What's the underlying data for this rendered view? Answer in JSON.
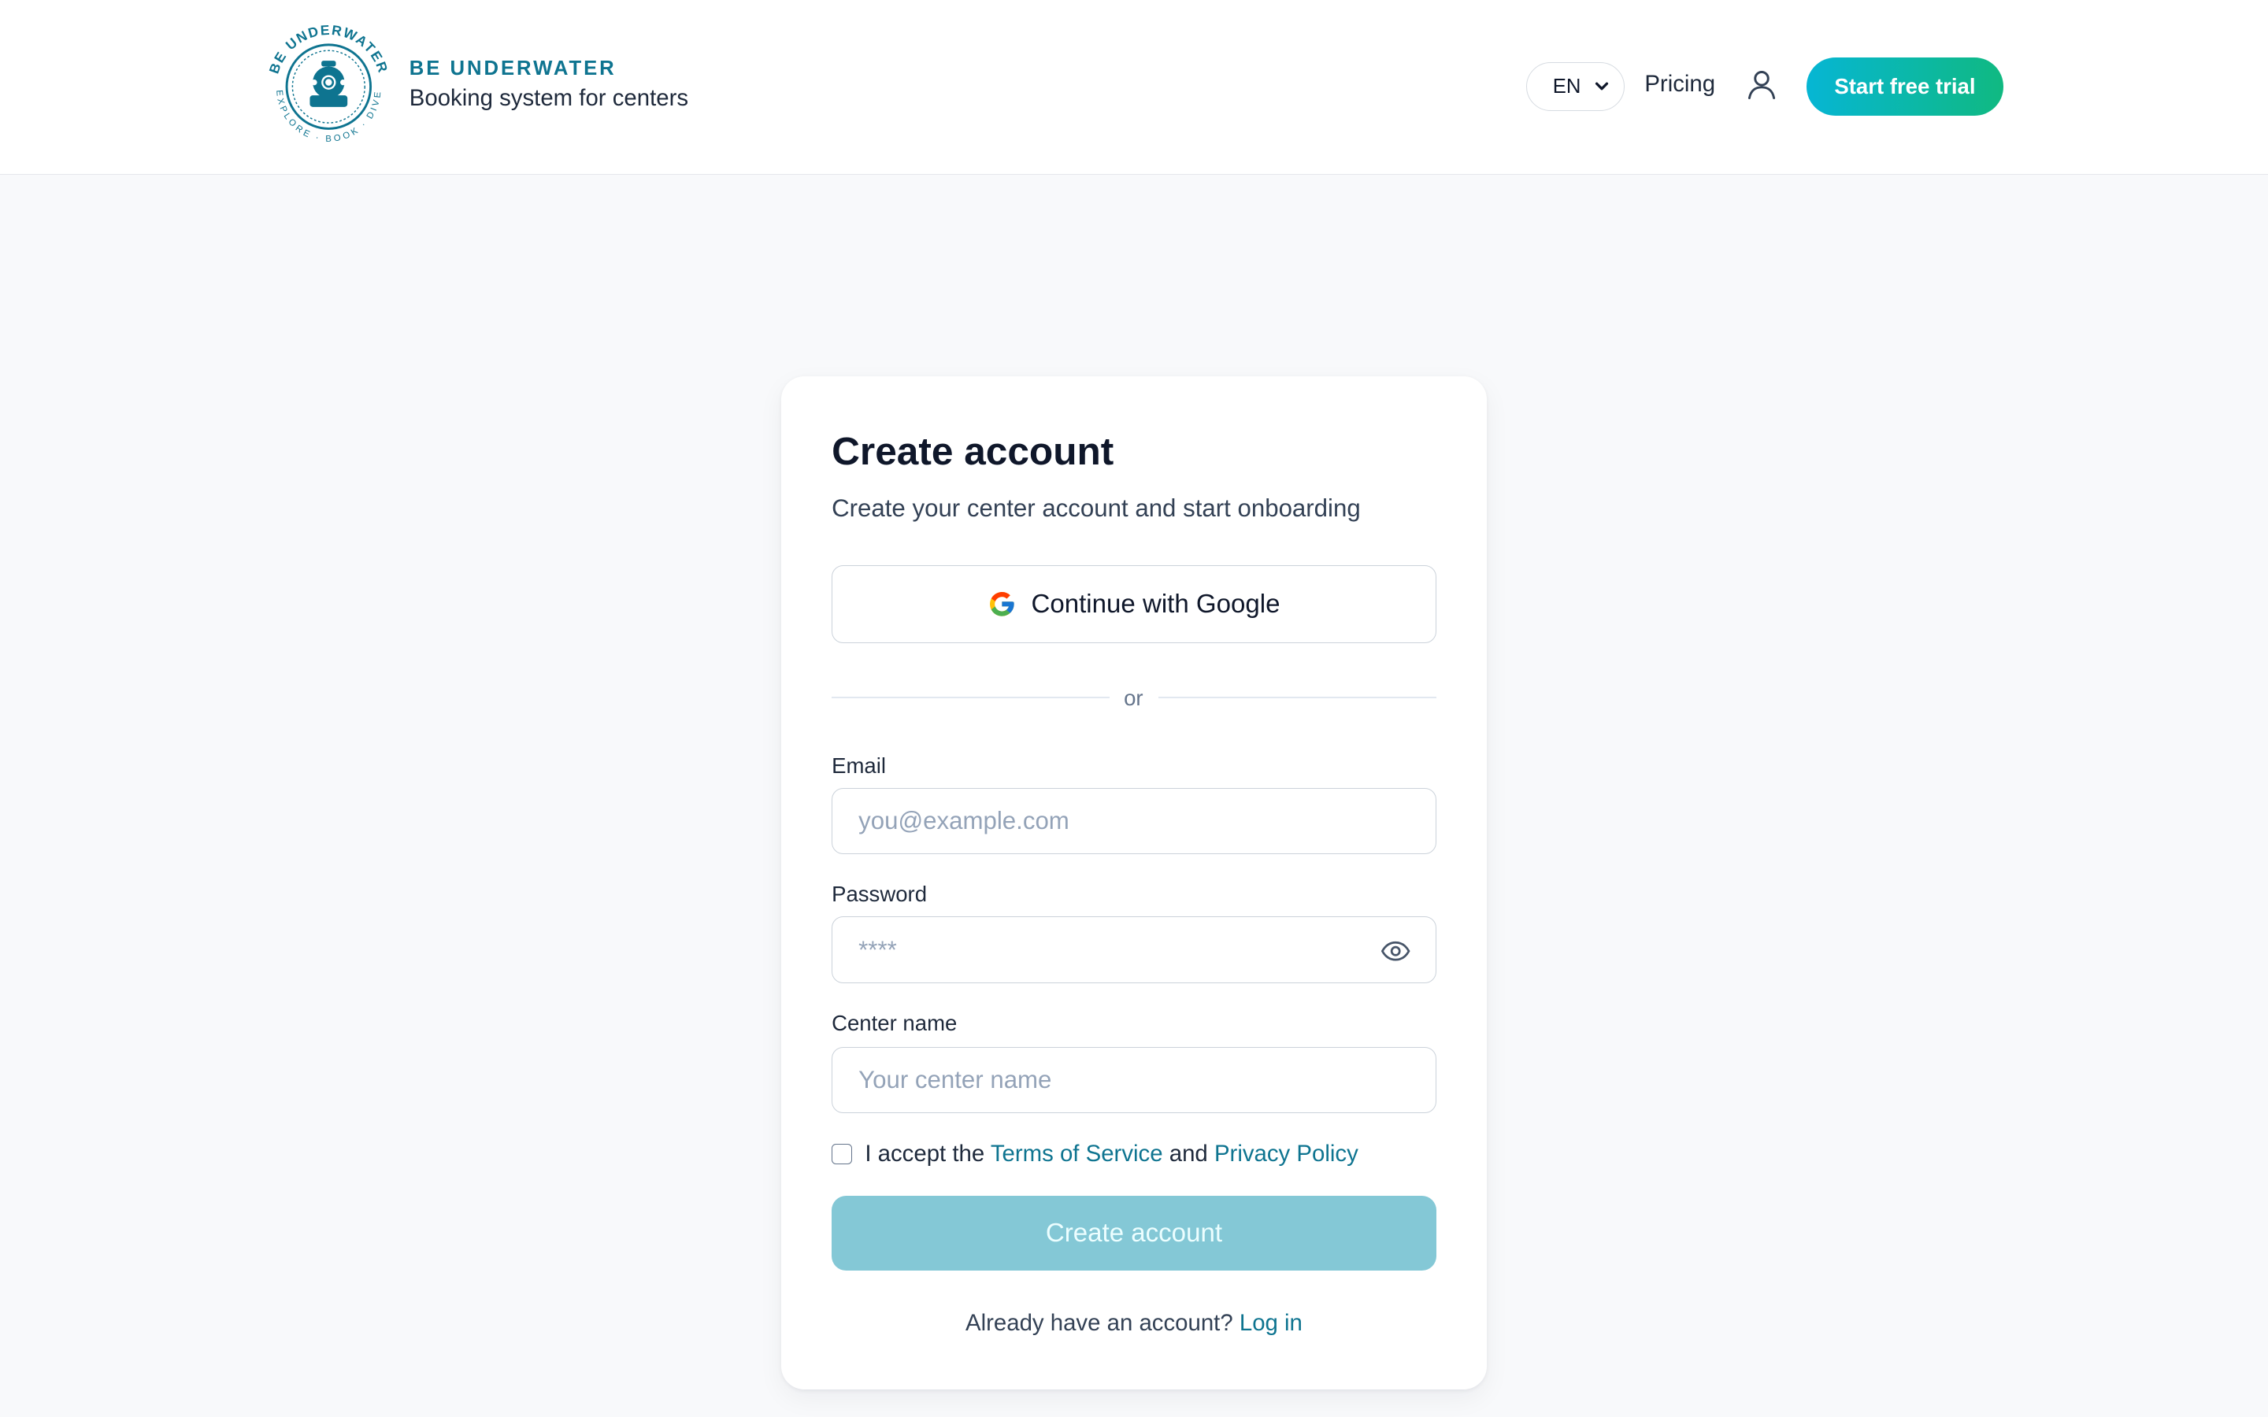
{
  "header": {
    "brand_name": "BE UNDERWATER",
    "brand_tagline": "Booking system for centers",
    "logo_ring_top_text": "BE UNDERWATER",
    "logo_ring_bottom_text": "EXPLORE · BOOK · DIVE",
    "language": "EN",
    "pricing_label": "Pricing",
    "trial_label": "Start free trial",
    "user_icon": "user-icon"
  },
  "form": {
    "title": "Create account",
    "subtitle": "Create your center account and start onboarding",
    "google_label": "Continue with Google",
    "divider_text": "or",
    "email_label": "Email",
    "email_placeholder": "you@example.com",
    "email_value": "",
    "password_label": "Password",
    "password_placeholder": "****",
    "password_value": "",
    "center_label": "Center name",
    "center_placeholder": "Your center name",
    "center_value": "",
    "terms_checked": false,
    "accept_prefix": "I accept the",
    "terms_link": "Terms of Service",
    "and_text": "and",
    "privacy_link": "Privacy Policy",
    "submit_label": "Create account",
    "login_prompt": "Already have an account?",
    "login_link": "Log in"
  },
  "colors": {
    "brand": "#0e7490",
    "trial_gradient_start": "#06b6d4",
    "trial_gradient_end": "#10b981",
    "submit_disabled": "#84c8d6",
    "page_background": "#f8f9fb"
  }
}
